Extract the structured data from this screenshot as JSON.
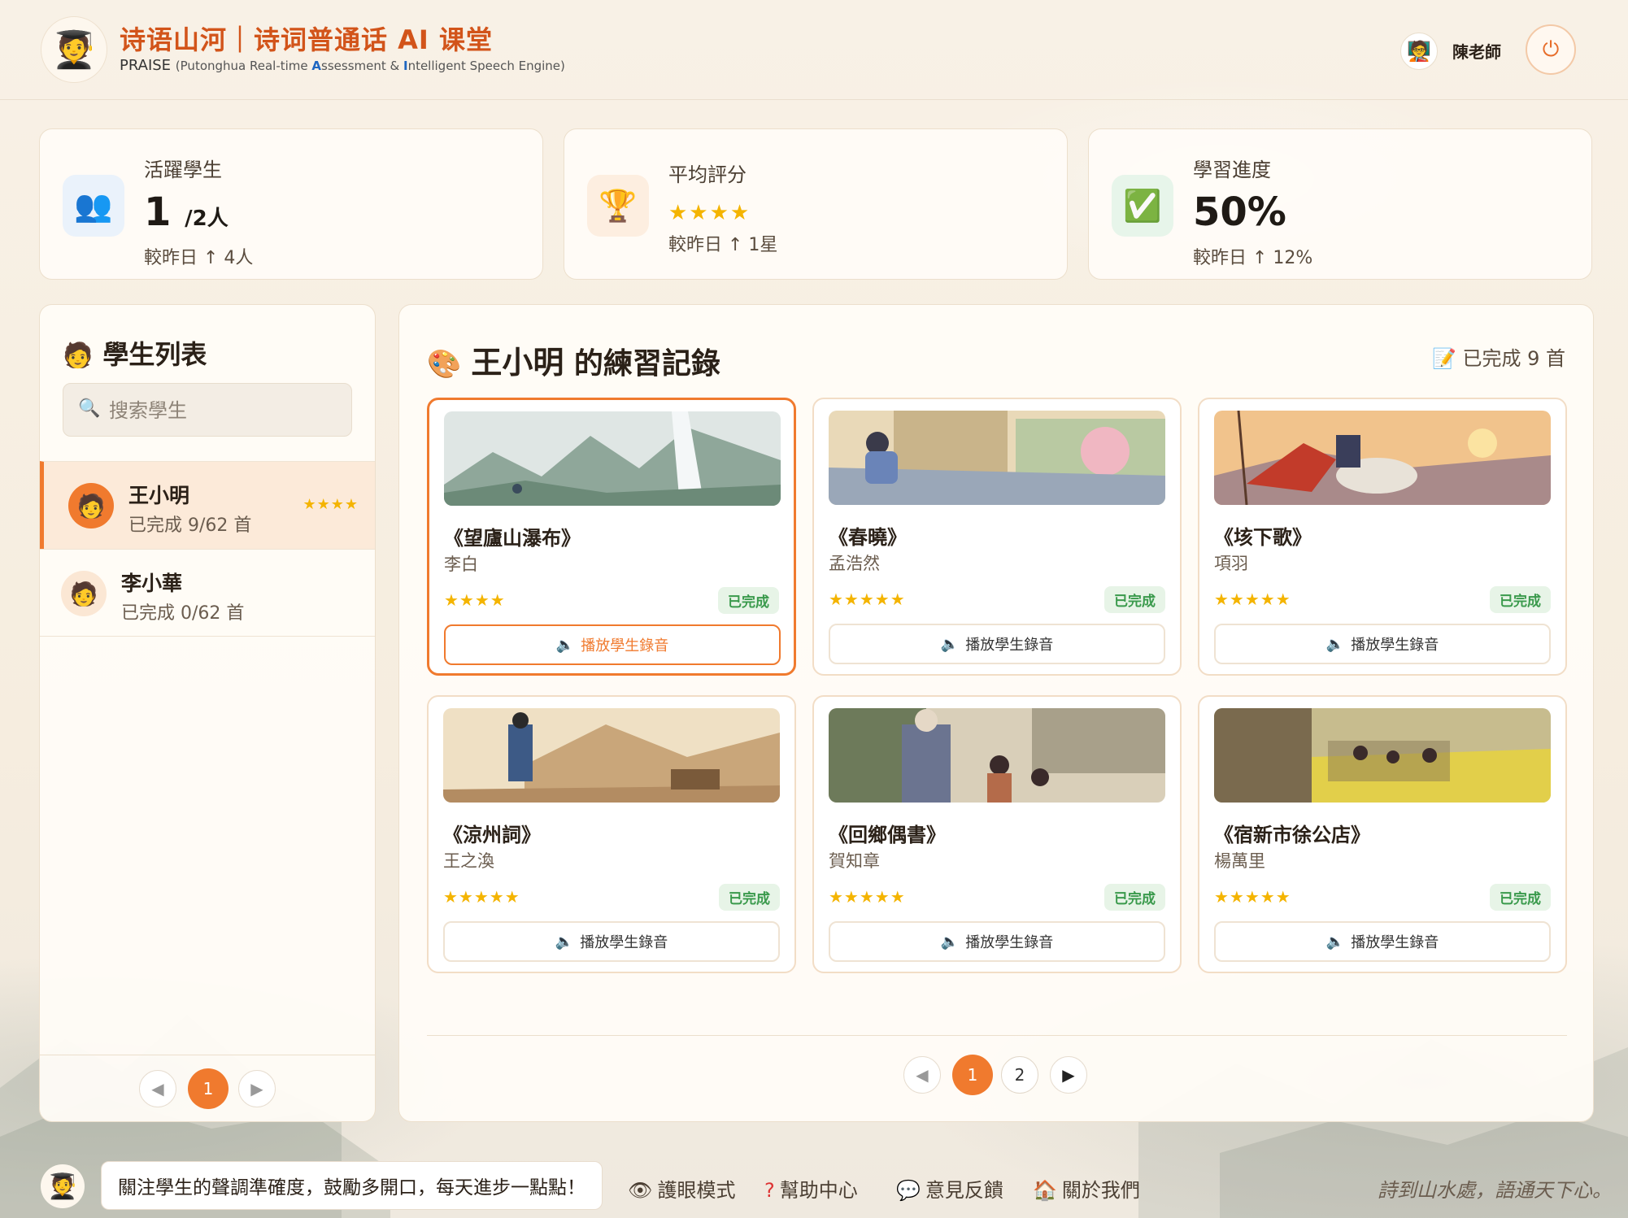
{
  "header": {
    "title": "诗语山河｜诗词普通话 AI 课堂",
    "subtitle_main": "PRAISE",
    "subtitle_open": "(Putonghua Real-time ",
    "subtitle_A": "A",
    "subtitle_mid": "ssessment & ",
    "subtitle_I": "I",
    "subtitle_end": "ntelligent Speech Engine)",
    "user_name": "陳老師"
  },
  "stats": [
    {
      "label": "活躍學生",
      "value": "1",
      "unit": "/2人",
      "delta": "較昨日 ↑ 4人"
    },
    {
      "label": "平均評分",
      "stars": "★★★★",
      "delta": "較昨日 ↑ 1星"
    },
    {
      "label": "學習進度",
      "value": "50%",
      "delta": "較昨日 ↑ 12%"
    }
  ],
  "students_panel": {
    "title": "學生列表",
    "search_placeholder": "搜索學生",
    "students": [
      {
        "name": "王小明",
        "progress": "已完成 9/62 首",
        "stars": "★★★★"
      },
      {
        "name": "李小華",
        "progress": "已完成 0/62 首",
        "stars": ""
      }
    ],
    "pager": {
      "current": "1",
      "prev": "◀",
      "next": "▶"
    }
  },
  "records_panel": {
    "student_name": "王小明",
    "title_suffix": "的練習記錄",
    "completed": "已完成 9 首",
    "play_label": "播放學生錄音",
    "poems": [
      {
        "title": "《望廬山瀑布》",
        "author": "李白",
        "stars": "★★★★",
        "status": "已完成"
      },
      {
        "title": "《春曉》",
        "author": "孟浩然",
        "stars": "★★★★★",
        "status": "已完成"
      },
      {
        "title": "《垓下歌》",
        "author": "項羽",
        "stars": "★★★★★",
        "status": "已完成"
      },
      {
        "title": "《涼州詞》",
        "author": "王之渙",
        "stars": "★★★★★",
        "status": "已完成"
      },
      {
        "title": "《回鄉偶書》",
        "author": "賀知章",
        "stars": "★★★★★",
        "status": "已完成"
      },
      {
        "title": "《宿新市徐公店》",
        "author": "楊萬里",
        "stars": "★★★★★",
        "status": "已完成"
      }
    ],
    "pager": {
      "pages": [
        "1",
        "2"
      ],
      "prev": "◀",
      "next": "▶"
    }
  },
  "footer": {
    "message": "關注學生的聲調準確度，鼓勵多開口，每天進步一點點！",
    "links": [
      "護眼模式",
      "幫助中心",
      "意見反饋",
      "關於我們"
    ],
    "slogan": "詩到山水處，語通天下心。"
  },
  "colors": {
    "accent": "#f07a2e",
    "title": "#d2541a",
    "star": "#f4b400",
    "success_badge": "#3a9a4c"
  },
  "icons": {
    "active_students": "people-icon",
    "average_score": "trophy-icon",
    "progress": "check-icon",
    "power": "power-icon",
    "search": "search-icon",
    "speaker": "speaker-icon",
    "palette": "palette-icon",
    "memo": "memo-icon"
  }
}
